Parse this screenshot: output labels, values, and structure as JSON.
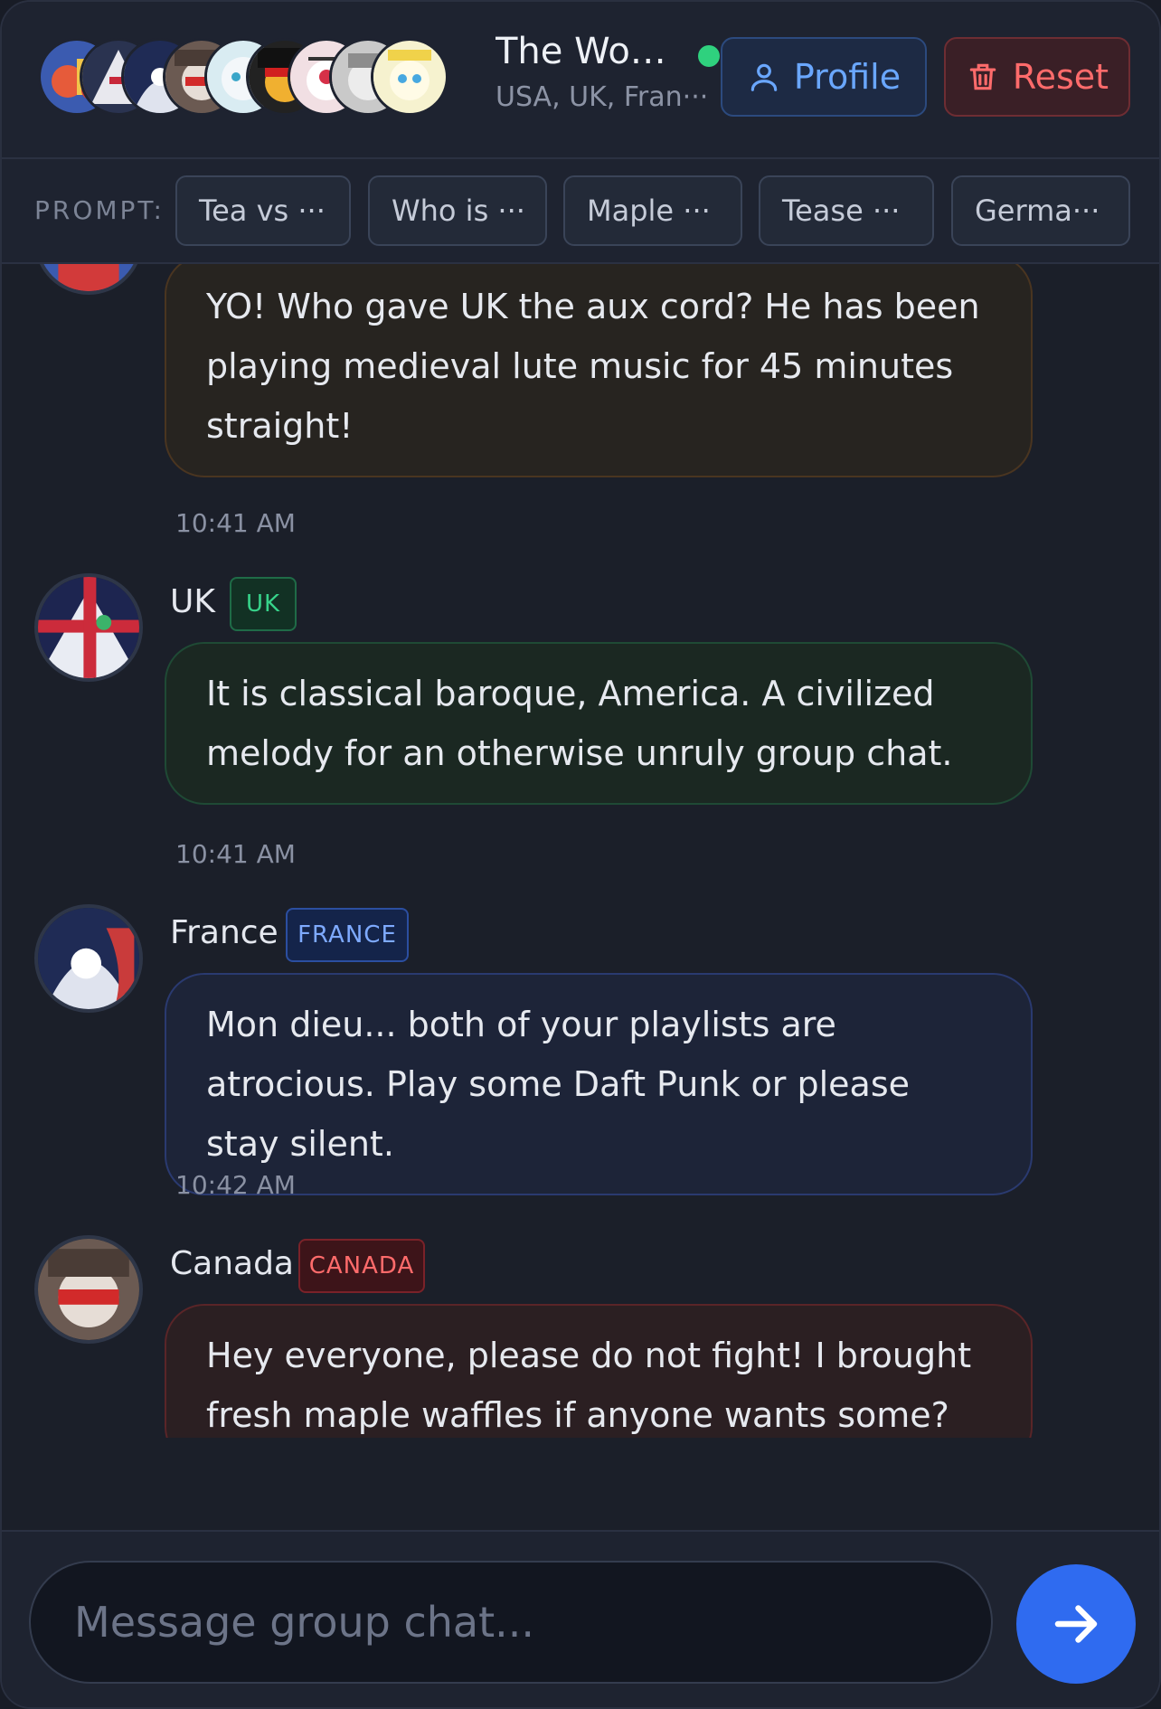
{
  "header": {
    "title": "The Wor···",
    "subtitle": "USA, UK, Fran···",
    "profile_label": "Profile",
    "reset_label": "Reset",
    "online_color": "#2fd17e"
  },
  "prompts": {
    "label": "PROMPT:",
    "chips": [
      "Tea vs ···",
      "Who is ···",
      "Maple ···",
      "Tease ···",
      "Germa···"
    ]
  },
  "messages": [
    {
      "sender": "",
      "badge": "",
      "text": "YO! Who gave UK the aux cord? He has been playing medieval lute music for 45 minutes straight!",
      "time": "10:41 AM"
    },
    {
      "sender": "UK",
      "badge": "UK",
      "text": "It is classical baroque, America. A civilized melody for an otherwise unruly group chat.",
      "time": "10:41 AM"
    },
    {
      "sender": "France",
      "badge": "FRANCE",
      "text": "Mon dieu... both of your playlists are atrocious. Play some Daft Punk or please stay silent.",
      "time": "10:42 AM"
    },
    {
      "sender": "Canada",
      "badge": "CANADA",
      "text": "Hey everyone, please do not fight! I brought fresh maple waffles if anyone wants some?",
      "time": ""
    }
  ],
  "composer": {
    "placeholder": "Message group chat..."
  },
  "colors": {
    "accent": "#2f6bf0",
    "profile": "#6aa7ff",
    "reset": "#ff6b6b",
    "uk": "#37d38a",
    "france": "#7eaaff",
    "canada": "#ff6b6b"
  }
}
